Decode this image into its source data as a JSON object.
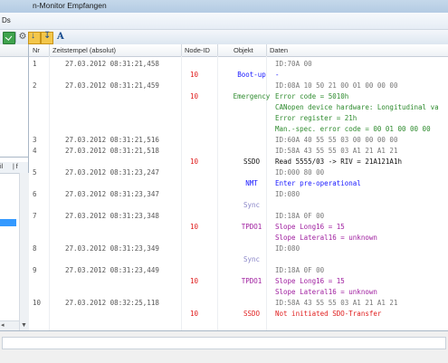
{
  "window": {
    "title": "n-Monitor Empfangen"
  },
  "menu": {
    "first_item": "Ds"
  },
  "grid": {
    "headers": {
      "nr": "Nr",
      "timestamp": "Zeitstempel (absolut)",
      "node_id": "Node-ID",
      "object": "Objekt",
      "data": "Daten"
    },
    "rows": [
      {
        "nr": "1",
        "ts": "27.03.2012  08:31:21,458",
        "node": "",
        "obj": "",
        "data": "ID:70A  00",
        "kind": "raw"
      },
      {
        "nr": "",
        "ts": "",
        "node": "10",
        "obj": "Boot-up",
        "data": "-",
        "kind": "blue"
      },
      {
        "nr": "2",
        "ts": "27.03.2012  08:31:21,459",
        "node": "",
        "obj": "",
        "data": "ID:08A  10 50 21 00 01 00 00 00",
        "kind": "raw"
      },
      {
        "nr": "",
        "ts": "",
        "node": "10",
        "obj": "Emergency",
        "data": "Error code = 5010h",
        "kind": "green"
      },
      {
        "nr": "",
        "ts": "",
        "node": "",
        "obj": "",
        "data": "CANopen device hardware: Longitudinal va",
        "kind": "green"
      },
      {
        "nr": "",
        "ts": "",
        "node": "",
        "obj": "",
        "data": "Error register = 21h",
        "kind": "green"
      },
      {
        "nr": "",
        "ts": "",
        "node": "",
        "obj": "",
        "data": "Man.-spec. error code = 00 01 00 00 00",
        "kind": "green"
      },
      {
        "nr": "3",
        "ts": "27.03.2012  08:31:21,516",
        "node": "",
        "obj": "",
        "data": "ID:60A  40 55 55 03 00 00 00 00",
        "kind": "raw"
      },
      {
        "nr": "4",
        "ts": "27.03.2012  08:31:21,518",
        "node": "",
        "obj": "",
        "data": "ID:58A  43 55 55 03 A1 21 A1 21",
        "kind": "raw"
      },
      {
        "nr": "",
        "ts": "",
        "node": "10",
        "obj": "SSDO",
        "data": "Read  5555/03 -> RIV = 21A121A1h",
        "kind": "black"
      },
      {
        "nr": "5",
        "ts": "27.03.2012  08:31:23,247",
        "node": "",
        "obj": "",
        "data": "ID:000  80 00",
        "kind": "raw"
      },
      {
        "nr": "",
        "ts": "",
        "node": "",
        "obj": "NMT",
        "data": "Enter pre-operational",
        "kind": "blue"
      },
      {
        "nr": "6",
        "ts": "27.03.2012  08:31:23,347",
        "node": "",
        "obj": "",
        "data": "ID:080",
        "kind": "raw"
      },
      {
        "nr": "",
        "ts": "",
        "node": "",
        "obj": "Sync",
        "data": "",
        "kind": "lav"
      },
      {
        "nr": "7",
        "ts": "27.03.2012  08:31:23,348",
        "node": "",
        "obj": "",
        "data": "ID:18A  0F 00",
        "kind": "raw"
      },
      {
        "nr": "",
        "ts": "",
        "node": "10",
        "obj": "TPDO1",
        "data": "Slope Long16 = 15",
        "kind": "purple"
      },
      {
        "nr": "",
        "ts": "",
        "node": "",
        "obj": "",
        "data": "Slope Lateral16 = unknown",
        "kind": "purple"
      },
      {
        "nr": "8",
        "ts": "27.03.2012  08:31:23,349",
        "node": "",
        "obj": "",
        "data": "ID:080",
        "kind": "raw"
      },
      {
        "nr": "",
        "ts": "",
        "node": "",
        "obj": "Sync",
        "data": "",
        "kind": "lav"
      },
      {
        "nr": "9",
        "ts": "27.03.2012  08:31:23,449",
        "node": "",
        "obj": "",
        "data": "ID:18A  0F 00",
        "kind": "raw"
      },
      {
        "nr": "",
        "ts": "",
        "node": "10",
        "obj": "TPDO1",
        "data": "Slope Long16 = 15",
        "kind": "purple"
      },
      {
        "nr": "",
        "ts": "",
        "node": "",
        "obj": "",
        "data": "Slope Lateral16 = unknown",
        "kind": "purple"
      },
      {
        "nr": "10",
        "ts": "27.03.2012  08:32:25,118",
        "node": "",
        "obj": "",
        "data": "ID:58A  43 55 55 03 A1 21 A1 21",
        "kind": "raw"
      },
      {
        "nr": "",
        "ts": "",
        "node": "10",
        "obj": "SSDO",
        "data": "Not initiated SDO-Transfer",
        "kind": "red"
      }
    ]
  },
  "colors": {
    "raw": "#777777",
    "blue": "#1a1aff",
    "green": "#2e8b2e",
    "black": "#111111",
    "lav": "#8a86c8",
    "purple": "#a020a0",
    "red": "#e02020",
    "node_red": "#e02020"
  },
  "icons": [
    "green-check-icon",
    "gear-icon",
    "download-icon",
    "align-icon",
    "font-icon"
  ]
}
